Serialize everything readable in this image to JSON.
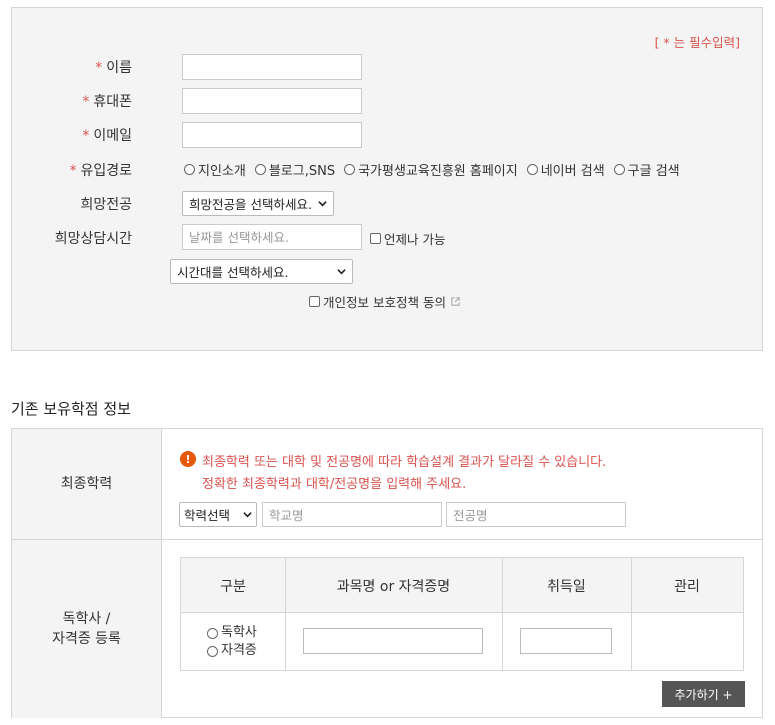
{
  "form": {
    "required_note": "[ * 는 필수입력]",
    "fields": {
      "name_label": "이름",
      "phone_label": "휴대폰",
      "email_label": "이메일",
      "source_label": "유입경로",
      "major_label": "희망전공",
      "time_label": "희망상담시간"
    },
    "required_mark": "*",
    "source_options": [
      "지인소개",
      "블로그,SNS",
      "국가평생교육진흥원 홈페이지",
      "네이버 검색",
      "구글 검색"
    ],
    "major_select": "희망전공을 선택하세요.",
    "date_placeholder": "날짜를 선택하세요.",
    "anytime_label": "언제나 가능",
    "time_select": "시간대를 선택하세요.",
    "privacy_label": "개인정보 보호정책 동의"
  },
  "credits": {
    "section_title": "기존 보유학점 정보",
    "education_label": "최종학력",
    "warning_line1": "최종학력 또는 대학 및 전공명에 따라 학습설계 결과가 달라질 수 있습니다.",
    "warning_line2": "정확한 최종학력과 대학/전공명을 입력해 주세요.",
    "warning_icon": "!",
    "education_select": "학력선택",
    "school_placeholder": "학교명",
    "major_placeholder": "전공명",
    "self_study_label_line1": "독학사 /",
    "self_study_label_line2": "자격증 등록",
    "table_headers": [
      "구분",
      "과목명 or 자격증명",
      "취득일",
      "관리"
    ],
    "type_options": [
      "독학사",
      "자격증"
    ],
    "add_button": "추가하기 +"
  },
  "colors": {
    "accent_red": "#d9534f",
    "warning_orange": "#e8590c",
    "button_dark": "#555555"
  }
}
